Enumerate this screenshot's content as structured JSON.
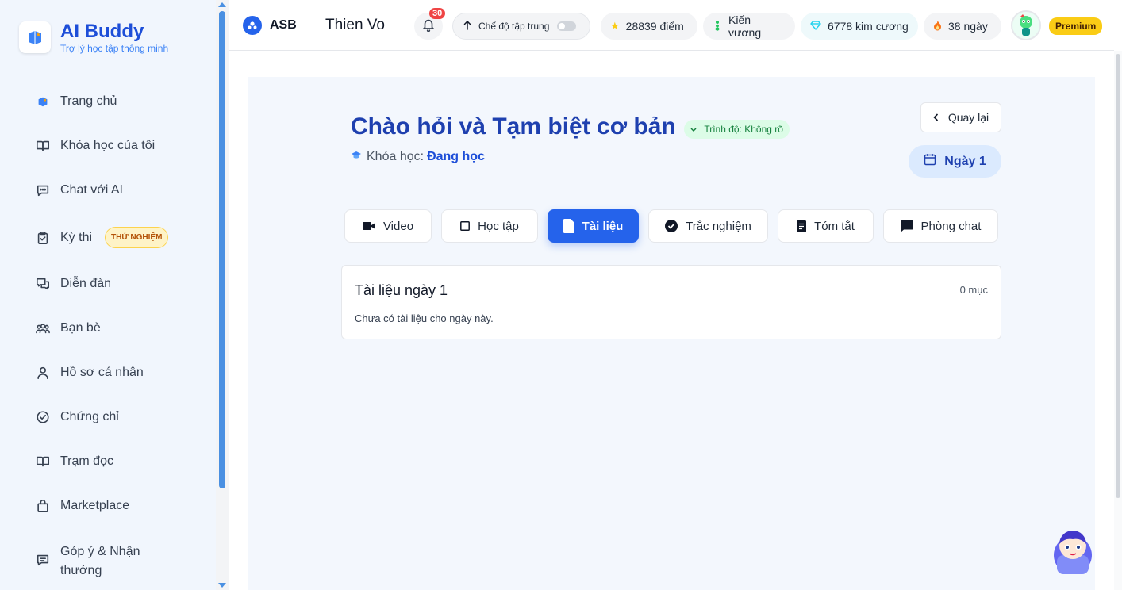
{
  "brand": {
    "title": "AI Buddy",
    "subtitle": "Trợ lý học tập thông minh"
  },
  "sidebar": {
    "items": [
      {
        "label": "Trang chủ",
        "icon": "home-logo-icon"
      },
      {
        "label": "Khóa học của tôi",
        "icon": "book-icon"
      },
      {
        "label": "Chat với AI",
        "icon": "chat-icon"
      },
      {
        "label": "Kỳ thi",
        "icon": "clipboard-icon",
        "badge": "THỬ NGHIỆM"
      },
      {
        "label": "Diễn đàn",
        "icon": "forum-icon"
      },
      {
        "label": "Bạn bè",
        "icon": "users-icon"
      },
      {
        "label": "Hồ sơ cá nhân",
        "icon": "user-icon"
      },
      {
        "label": "Chứng chỉ",
        "icon": "check-circle-icon"
      },
      {
        "label": "Trạm đọc",
        "icon": "open-book-icon"
      },
      {
        "label": "Marketplace",
        "icon": "shopping-bag-icon"
      },
      {
        "label": "Góp ý & Nhận thưởng",
        "icon": "feedback-icon"
      }
    ]
  },
  "topbar": {
    "org": "ASB",
    "username": "Thien Vo",
    "notifications": "30",
    "focus_mode": "Chế độ tập trung",
    "points": "28839 điểm",
    "rank": "Kiến vương",
    "diamonds": "6778 kim cương",
    "streak": "38 ngày",
    "plan": "Premium"
  },
  "lesson": {
    "title": "Chào hỏi và Tạm biệt cơ bản",
    "level": "Trình độ: Không rõ",
    "course_label": "Khóa học:",
    "course_status": "Đang học",
    "back": "Quay lại",
    "day": "Ngày 1"
  },
  "tabs": [
    {
      "label": "Video",
      "icon": "video-icon",
      "active": false
    },
    {
      "label": "Học tập",
      "icon": "square-icon",
      "active": false
    },
    {
      "label": "Tài liệu",
      "icon": "document-icon",
      "active": true
    },
    {
      "label": "Trắc nghiệm",
      "icon": "check-badge-icon",
      "active": false
    },
    {
      "label": "Tóm tắt",
      "icon": "summary-icon",
      "active": false
    },
    {
      "label": "Phòng chat",
      "icon": "chat-bubble-icon",
      "active": false
    }
  ],
  "documents": {
    "title": "Tài liệu ngày 1",
    "count": "0 mục",
    "empty": "Chưa có tài liệu cho ngày này."
  },
  "colors": {
    "primary": "#2563eb",
    "title": "#1e40af",
    "premium": "#facc15",
    "badge_red": "#ef4444"
  }
}
